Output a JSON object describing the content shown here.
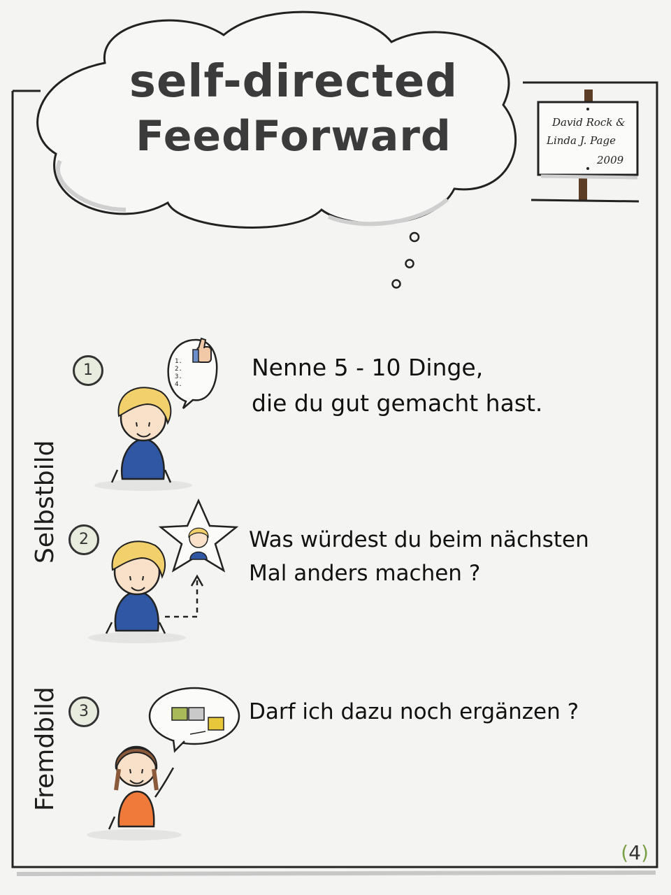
{
  "title": {
    "line1": "self-directed",
    "line2": "FeedForward"
  },
  "sign": {
    "line1": "David Rock &",
    "line2": "Linda J. Page",
    "line3": "2009"
  },
  "side_labels": {
    "self": "Selbstbild",
    "other": "Fremdbild"
  },
  "steps": [
    {
      "number": "1",
      "line1": "Nenne 5 - 10 Dinge,",
      "line2": "die du gut gemacht hast."
    },
    {
      "number": "2",
      "line1": "Was würdest du beim nächsten",
      "line2": "Mal anders machen ?"
    },
    {
      "number": "3",
      "line1": "Darf ich dazu noch ergänzen ?"
    }
  ],
  "speech_list": [
    "1.",
    "2.",
    "3.",
    "4."
  ],
  "page_number": "4",
  "colors": {
    "shirt_blue": "#2f57a3",
    "shirt_orange": "#ef7a3a",
    "hair_blond": "#f2d06b",
    "hair_brown": "#8a5a3b",
    "puzzle_green": "#a8b95a",
    "puzzle_yellow": "#e8c73a",
    "accent_green": "#7a9f46"
  }
}
